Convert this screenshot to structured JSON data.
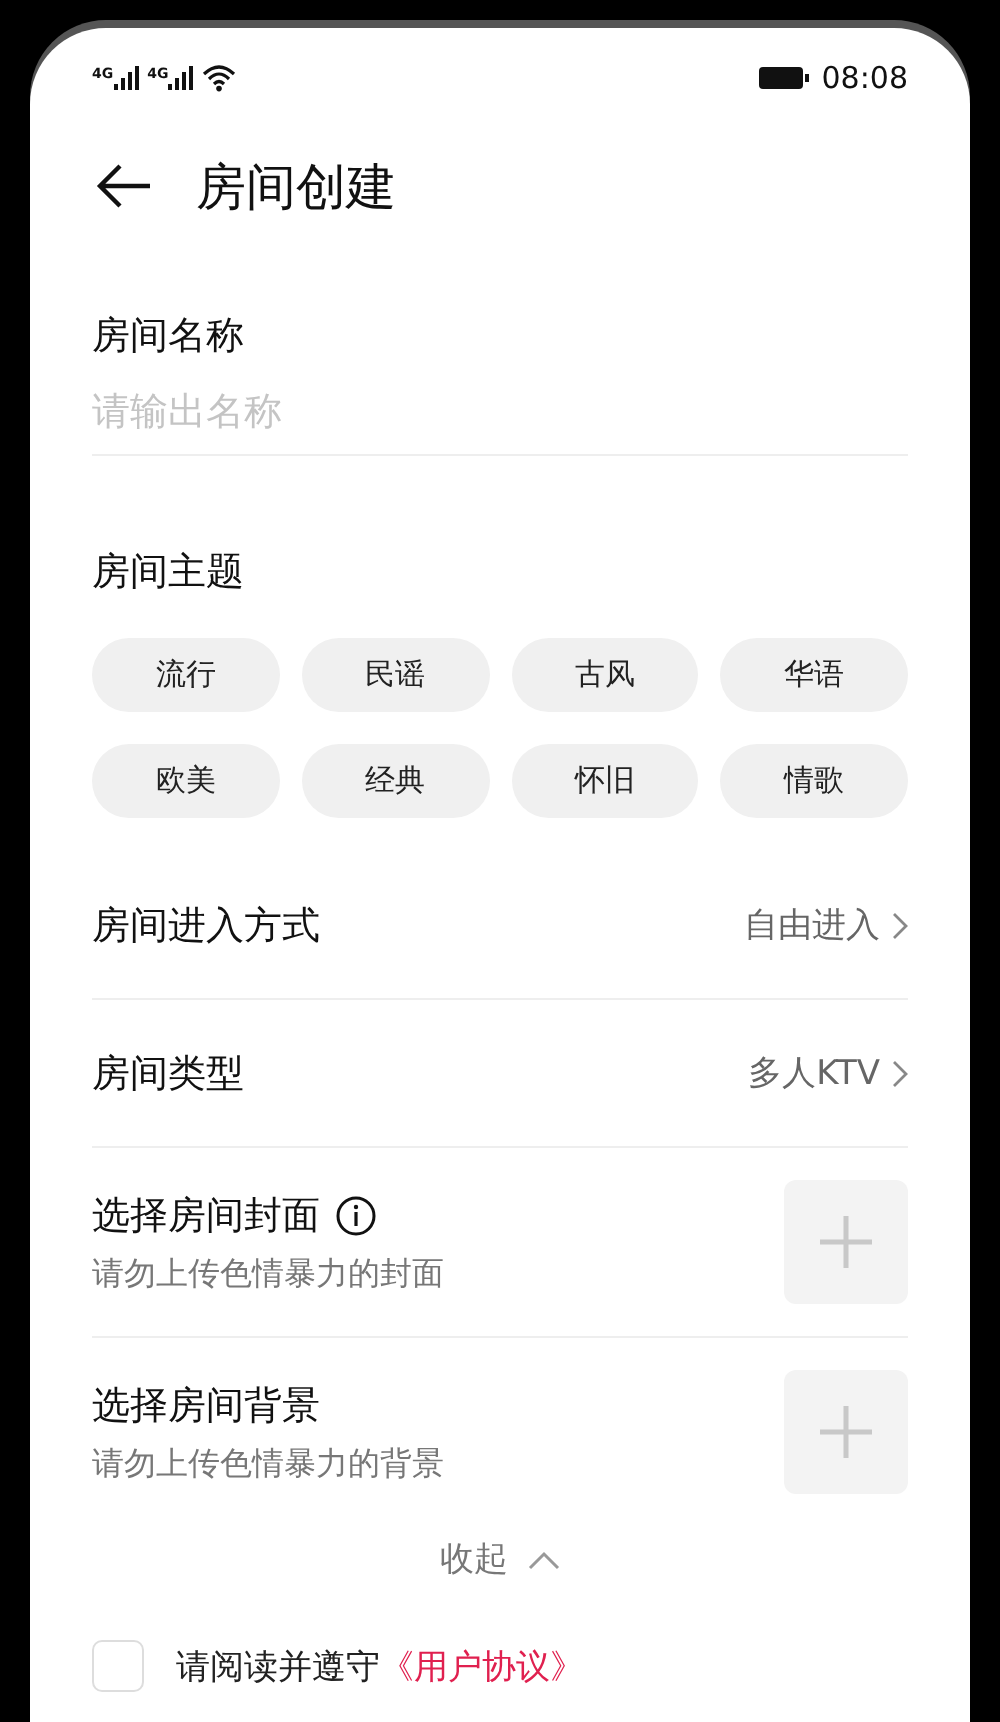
{
  "status_bar": {
    "network_labels": [
      "4G",
      "4G"
    ],
    "time": "08:08"
  },
  "header": {
    "title": "房间创建"
  },
  "name_field": {
    "label": "房间名称",
    "placeholder": "请输出名称"
  },
  "theme": {
    "label": "房间主题",
    "chips": [
      {
        "label": "流行",
        "selected": false
      },
      {
        "label": "民谣",
        "selected": false
      },
      {
        "label": "古风",
        "selected": false
      },
      {
        "label": "华语",
        "selected": false
      },
      {
        "label": "欧美",
        "selected": false
      },
      {
        "label": "经典",
        "selected": false
      },
      {
        "label": "怀旧",
        "selected": false
      },
      {
        "label": "情歌",
        "selected": false
      }
    ]
  },
  "settings": [
    {
      "label": "房间进入方式",
      "value": "自由进入"
    },
    {
      "label": "房间类型",
      "value": "多人KTV"
    }
  ],
  "uploads": [
    {
      "title": "选择房间封面",
      "info": true,
      "hint": "请勿上传色情暴力的封面"
    },
    {
      "title": "选择房间背景",
      "info": false,
      "hint": "请勿上传色情暴力的背景"
    }
  ],
  "collapse": {
    "label": "收起"
  },
  "agreement": {
    "checked": false,
    "text": "请阅读并遵守",
    "link": "《用户协议》"
  }
}
